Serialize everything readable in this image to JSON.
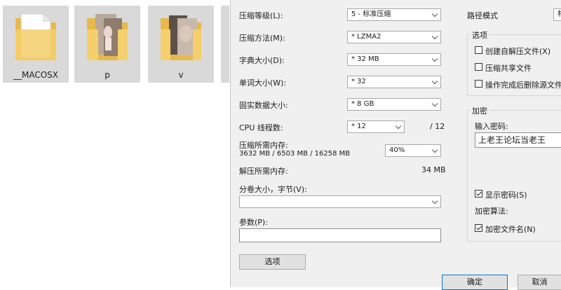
{
  "explorer": {
    "folders": [
      {
        "name": "__MACOSX",
        "kind": "empty"
      },
      {
        "name": "p",
        "kind": "photo"
      },
      {
        "name": "v",
        "kind": "photo"
      }
    ]
  },
  "dialog": {
    "level": {
      "label": "压缩等级(L):",
      "value": "5 - 标准压缩"
    },
    "method": {
      "label": "压缩方法(M):",
      "value": "* LZMA2"
    },
    "dict": {
      "label": "字典大小(D):",
      "value": "* 32 MB"
    },
    "word": {
      "label": "单词大小(W):",
      "value": "* 32"
    },
    "solid": {
      "label": "固实数据大小:",
      "value": "* 8 GB"
    },
    "cpu": {
      "label": "CPU 线程数:",
      "value": "* 12",
      "total": "/ 12"
    },
    "mem_compress": {
      "label": "压缩所需内存:",
      "detail": "3632 MB / 6503 MB / 16258 MB",
      "value": "40%"
    },
    "mem_decompress": {
      "label": "解压所需内存:",
      "value": "34 MB"
    },
    "volume": {
      "label": "分卷大小，字节(V):",
      "value": ""
    },
    "params": {
      "label": "参数(P):",
      "value": ""
    },
    "options_button": "选项",
    "path_mode": {
      "label": "路径模式",
      "value": "相"
    },
    "options_group": {
      "title": "选项",
      "sfx": "创建自解压文件(X)",
      "shared": "压缩共享文件",
      "delete": "操作完成后删除源文件"
    },
    "encryption": {
      "title": "加密",
      "password_label": "输入密码:",
      "password_value": "上老王论坛当老王",
      "show_password": "显示密码(S)",
      "method_label": "加密算法:",
      "encrypt_names": "加密文件名(N)"
    },
    "ok_button": "确定",
    "cancel_button": "取消"
  }
}
